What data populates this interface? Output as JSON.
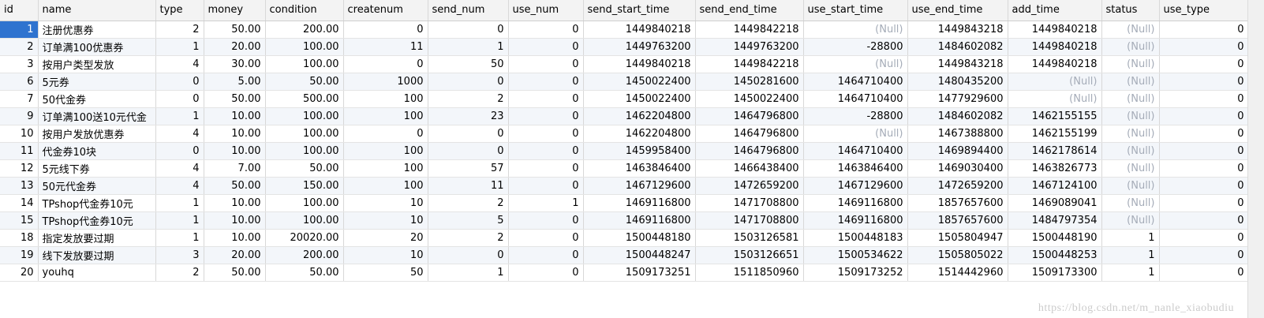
{
  "table": {
    "columns": [
      "id",
      "name",
      "type",
      "money",
      "condition",
      "createnum",
      "send_num",
      "use_num",
      "send_start_time",
      "send_end_time",
      "use_start_time",
      "use_end_time",
      "add_time",
      "status",
      "use_type"
    ],
    "rows": [
      [
        "1",
        "注册优惠券",
        "2",
        "50.00",
        "200.00",
        "0",
        "0",
        "0",
        "1449840218",
        "1449842218",
        "(Null)",
        "1449843218",
        "1449840218",
        "(Null)",
        "0"
      ],
      [
        "2",
        "订单满100优惠券",
        "1",
        "20.00",
        "100.00",
        "11",
        "1",
        "0",
        "1449763200",
        "1449763200",
        "-28800",
        "1484602082",
        "1449840218",
        "(Null)",
        "0"
      ],
      [
        "3",
        "按用户类型发放",
        "4",
        "30.00",
        "100.00",
        "0",
        "50",
        "0",
        "1449840218",
        "1449842218",
        "(Null)",
        "1449843218",
        "1449840218",
        "(Null)",
        "0"
      ],
      [
        "6",
        "5元券",
        "0",
        "5.00",
        "50.00",
        "1000",
        "0",
        "0",
        "1450022400",
        "1450281600",
        "1464710400",
        "1480435200",
        "(Null)",
        "(Null)",
        "0"
      ],
      [
        "7",
        "50代金券",
        "0",
        "50.00",
        "500.00",
        "100",
        "2",
        "0",
        "1450022400",
        "1450022400",
        "1464710400",
        "1477929600",
        "(Null)",
        "(Null)",
        "0"
      ],
      [
        "9",
        "订单满100送10元代金",
        "1",
        "10.00",
        "100.00",
        "100",
        "23",
        "0",
        "1462204800",
        "1464796800",
        "-28800",
        "1484602082",
        "1462155155",
        "(Null)",
        "0"
      ],
      [
        "10",
        "按用户发放优惠券",
        "4",
        "10.00",
        "100.00",
        "0",
        "0",
        "0",
        "1462204800",
        "1464796800",
        "(Null)",
        "1467388800",
        "1462155199",
        "(Null)",
        "0"
      ],
      [
        "11",
        "代金券10块",
        "0",
        "10.00",
        "100.00",
        "100",
        "0",
        "0",
        "1459958400",
        "1464796800",
        "1464710400",
        "1469894400",
        "1462178614",
        "(Null)",
        "0"
      ],
      [
        "12",
        "5元线下券",
        "4",
        "7.00",
        "50.00",
        "100",
        "57",
        "0",
        "1463846400",
        "1466438400",
        "1463846400",
        "1469030400",
        "1463826773",
        "(Null)",
        "0"
      ],
      [
        "13",
        "50元代金券",
        "4",
        "50.00",
        "150.00",
        "100",
        "11",
        "0",
        "1467129600",
        "1472659200",
        "1467129600",
        "1472659200",
        "1467124100",
        "(Null)",
        "0"
      ],
      [
        "14",
        "TPshop代金券10元",
        "1",
        "10.00",
        "100.00",
        "10",
        "2",
        "1",
        "1469116800",
        "1471708800",
        "1469116800",
        "1857657600",
        "1469089041",
        "(Null)",
        "0"
      ],
      [
        "15",
        "TPshop代金券10元",
        "1",
        "10.00",
        "100.00",
        "10",
        "5",
        "0",
        "1469116800",
        "1471708800",
        "1469116800",
        "1857657600",
        "1484797354",
        "(Null)",
        "0"
      ],
      [
        "18",
        "指定发放要过期",
        "1",
        "10.00",
        "20020.00",
        "20",
        "2",
        "0",
        "1500448180",
        "1503126581",
        "1500448183",
        "1505804947",
        "1500448190",
        "1",
        "0"
      ],
      [
        "19",
        "线下发放要过期",
        "3",
        "20.00",
        "200.00",
        "10",
        "0",
        "0",
        "1500448247",
        "1503126651",
        "1500534622",
        "1505805022",
        "1500448253",
        "1",
        "0"
      ],
      [
        "20",
        "youhq",
        "2",
        "50.00",
        "50.00",
        "50",
        "1",
        "0",
        "1509173251",
        "1511850960",
        "1509173252",
        "1514442960",
        "1509173300",
        "1",
        "0"
      ]
    ],
    "selected_row": 0
  },
  "watermark": "https://blog.csdn.net/m_nanle_xiaobudiu"
}
